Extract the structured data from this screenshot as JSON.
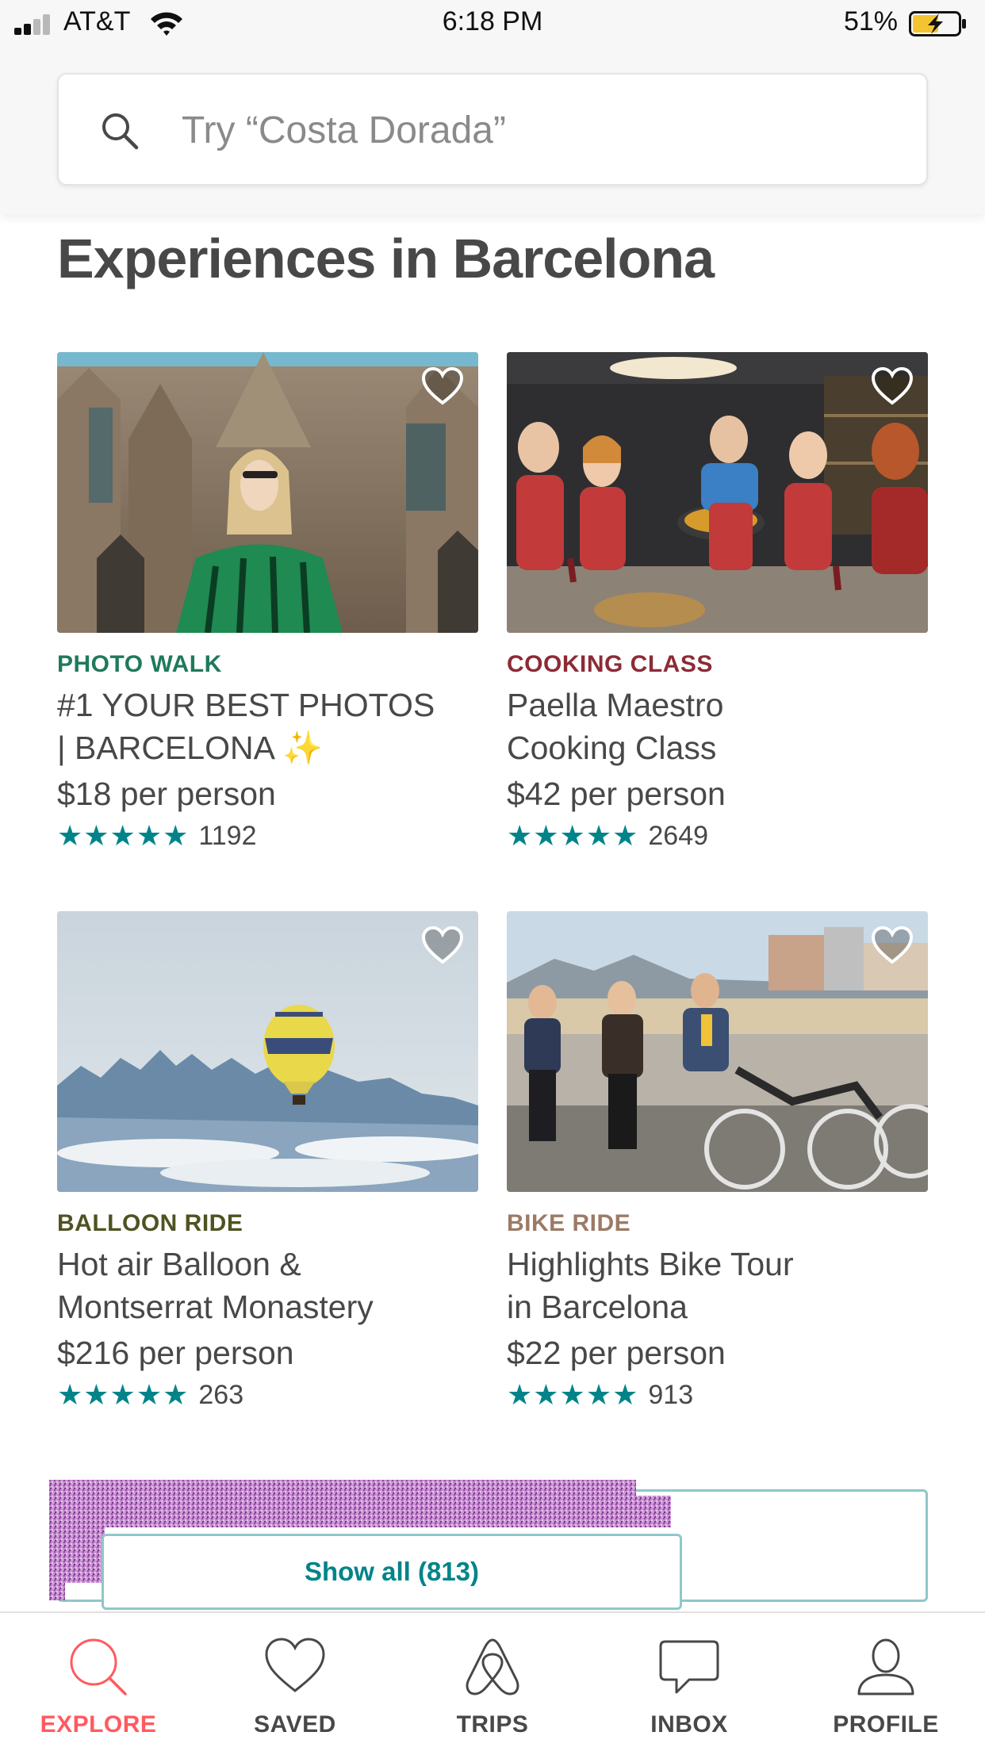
{
  "status_bar": {
    "carrier": "AT&T",
    "time": "6:18 PM",
    "battery": "51%"
  },
  "search": {
    "placeholder": "Try “Costa Dorada”",
    "icon": "search-icon"
  },
  "section": {
    "title": "Experiences in Barcelona"
  },
  "experiences": [
    {
      "category": "PHOTO WALK",
      "category_color": "#1F7A5A",
      "title_line1": "#1 YOUR BEST PHOTOS",
      "title_line2": "| BARCELONA ✨",
      "price": "$18 per person",
      "stars": "★★★★★",
      "rating": 5,
      "reviews": "1192",
      "saved": false
    },
    {
      "category": "COOKING CLASS",
      "category_color": "#8C2B36",
      "title_line1": "Paella Maestro",
      "title_line2": "Cooking Class",
      "price": "$42 per person",
      "stars": "★★★★★",
      "rating": 5,
      "reviews": "2649",
      "saved": false
    },
    {
      "category": "BALLOON RIDE",
      "category_color": "#4F5322",
      "title_line1": "Hot air Balloon &",
      "title_line2": "Montserrat Monastery",
      "price": "$216 per person",
      "stars": "★★★★★",
      "rating": 5,
      "reviews": "263",
      "saved": false
    },
    {
      "category": "BIKE RIDE",
      "category_color": "#9C7A66",
      "title_line1": "Highlights Bike Tour",
      "title_line2": "in Barcelona",
      "price": "$22 per person",
      "stars": "★★★★★",
      "rating": 5,
      "reviews": "913",
      "saved": false
    }
  ],
  "show_all": {
    "label": "Show all (813)"
  },
  "tab_bar": {
    "tabs": [
      {
        "label": "EXPLORE",
        "icon": "search-icon",
        "active": true
      },
      {
        "label": "SAVED",
        "icon": "heart-icon",
        "active": false
      },
      {
        "label": "TRIPS",
        "icon": "airbnb-logo-icon",
        "active": false
      },
      {
        "label": "INBOX",
        "icon": "chat-bubble-icon",
        "active": false
      },
      {
        "label": "PROFILE",
        "icon": "person-icon",
        "active": false
      }
    ]
  },
  "colors": {
    "accent": "#FF5A5F",
    "teal": "#008489",
    "text": "#484848"
  }
}
